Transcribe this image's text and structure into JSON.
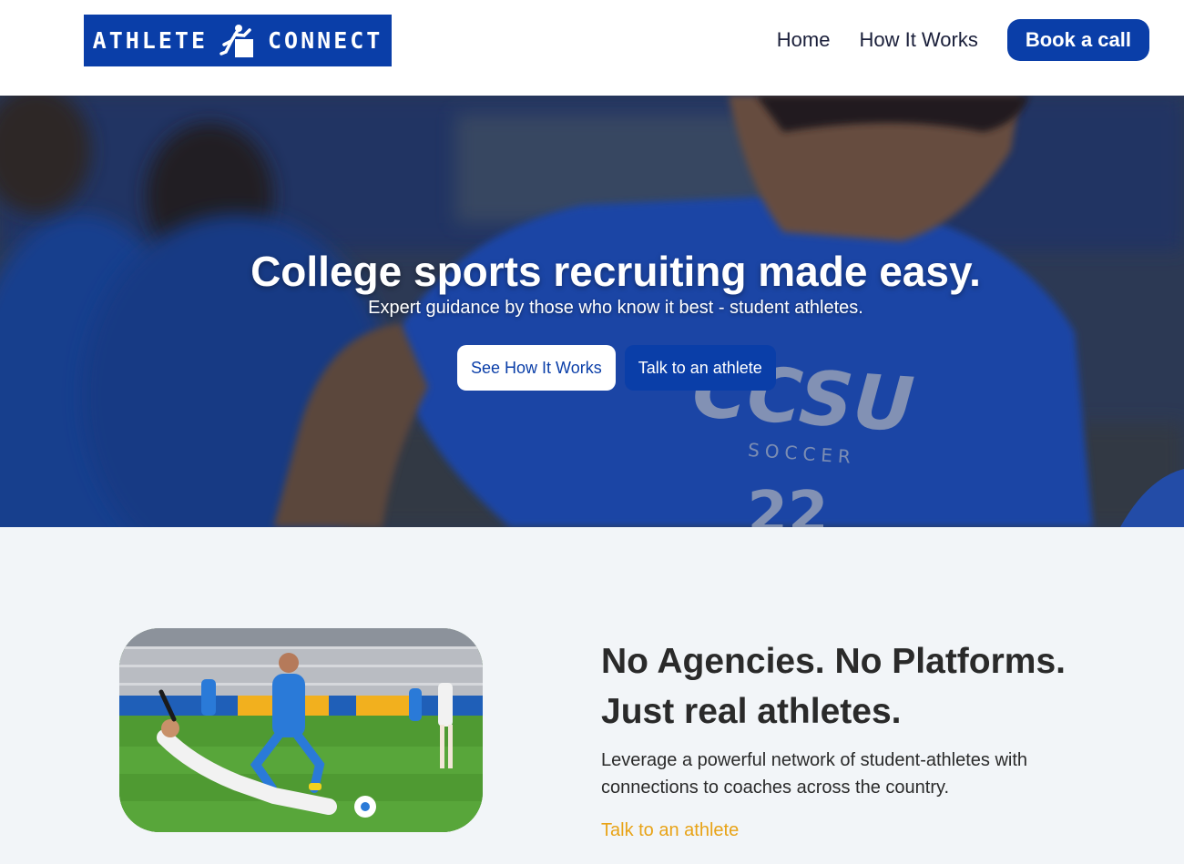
{
  "header": {
    "logo": {
      "left_text": "ATHLETE",
      "right_text": "CONNECT",
      "icon": "athlete-box-icon"
    },
    "nav": {
      "home_label": "Home",
      "how_label": "How It Works",
      "cta_label": "Book a call"
    }
  },
  "hero": {
    "title": "College sports recruiting made easy.",
    "subtitle": "Expert guidance by those who know it best - student athletes.",
    "primary_button": "See How It Works",
    "secondary_button": "Talk to an athlete",
    "photo_jersey_text": "CCSU",
    "photo_jersey_subtext": "SOCCER",
    "photo_jersey_number": "22"
  },
  "feature": {
    "heading_line1": "No Agencies. No Platforms.",
    "heading_line2": "Just real athletes.",
    "text": "Leverage a powerful network of student-athletes with connections to coaches across the country.",
    "link_label": "Talk to an athlete"
  },
  "colors": {
    "brand_blue": "#0a3ea8",
    "accent_gold": "#e8a317",
    "text_dark": "#2a2a2a",
    "section_bg": "#f2f5f8"
  }
}
